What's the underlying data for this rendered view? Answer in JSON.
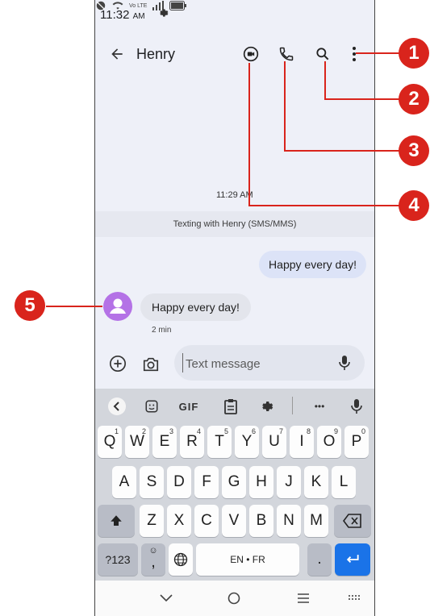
{
  "status_bar": {
    "time": "11:32",
    "ampm": "AM",
    "net_label": "Vo LTE"
  },
  "header": {
    "contact_name": "Henry"
  },
  "conversation": {
    "timestamp": "11:29 AM",
    "banner": "Texting with Henry (SMS/MMS)",
    "outgoing": [
      {
        "text": "Happy every day!"
      }
    ],
    "incoming": [
      {
        "text": "Happy every day!",
        "time": "2 min"
      }
    ]
  },
  "composer": {
    "placeholder": "Text message"
  },
  "keyboard": {
    "toolbar": {
      "gif": "GIF",
      "more": "•••"
    },
    "row1": [
      {
        "k": "Q",
        "s": "1"
      },
      {
        "k": "W",
        "s": "2"
      },
      {
        "k": "E",
        "s": "3"
      },
      {
        "k": "R",
        "s": "4"
      },
      {
        "k": "T",
        "s": "5"
      },
      {
        "k": "Y",
        "s": "6"
      },
      {
        "k": "U",
        "s": "7"
      },
      {
        "k": "I",
        "s": "8"
      },
      {
        "k": "O",
        "s": "9"
      },
      {
        "k": "P",
        "s": "0"
      }
    ],
    "row2": [
      "A",
      "S",
      "D",
      "F",
      "G",
      "H",
      "J",
      "K",
      "L"
    ],
    "row3": [
      "Z",
      "X",
      "C",
      "V",
      "B",
      "N",
      "M"
    ],
    "symbols_label": "?123",
    "comma": ",",
    "space_label": "EN • FR",
    "period": "."
  },
  "callouts": [
    "1",
    "2",
    "3",
    "4",
    "5"
  ],
  "colors": {
    "callout": "#d9241c",
    "avatar": "#b472e6",
    "enter_key": "#1a73e8"
  }
}
